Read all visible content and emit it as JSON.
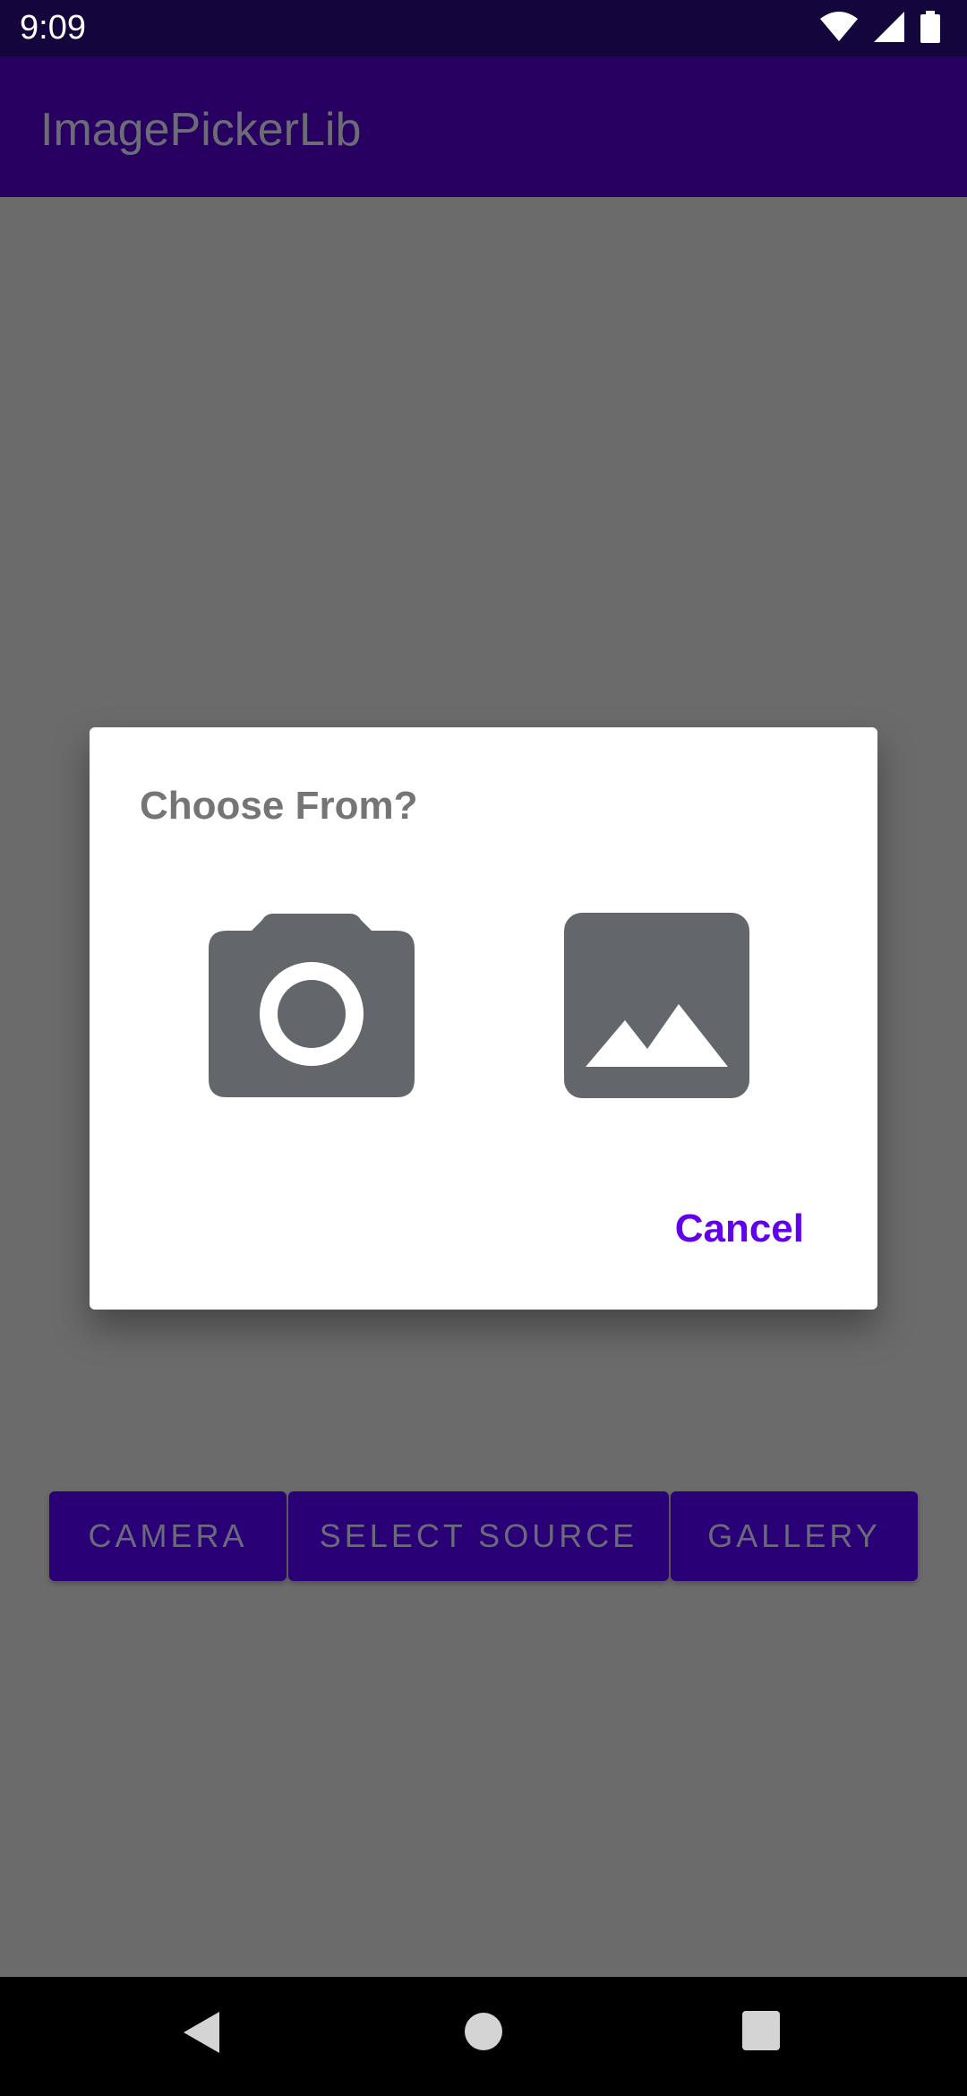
{
  "status_bar": {
    "time": "9:09",
    "icons": [
      "wifi-icon",
      "signal-icon",
      "battery-icon"
    ]
  },
  "app_bar": {
    "title": "ImagePickerLib"
  },
  "buttons": {
    "camera": "CAMERA",
    "select_source": "SELECT SOURCE",
    "gallery": "GALLERY"
  },
  "dialog": {
    "title": "Choose From?",
    "options": [
      "camera-icon",
      "image-icon"
    ],
    "cancel": "Cancel"
  },
  "nav_bar": {
    "icons": [
      "back-icon",
      "home-icon",
      "recents-icon"
    ]
  },
  "colors": {
    "status_bar": "#14063d",
    "app_bar": "#270061",
    "button": "#2a0077",
    "accent": "#6200ee",
    "scrim_background": "#6b6b6b",
    "icon_gray": "#63666b"
  }
}
